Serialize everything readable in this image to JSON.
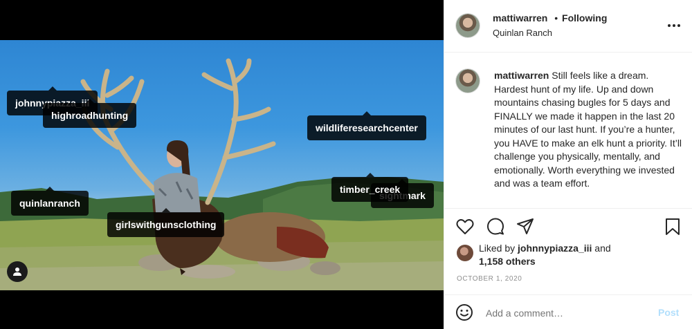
{
  "post": {
    "username": "mattiwarren",
    "follow_separator": "•",
    "follow_status": "Following",
    "location": "Quinlan Ranch",
    "more_icon": "more-horizontal-icon"
  },
  "media": {
    "tags": [
      {
        "name": "tag-johnnypiazza",
        "label": "johnnypiazza_iii"
      },
      {
        "name": "tag-highroadhunting",
        "label": "highroadhunting"
      },
      {
        "name": "tag-wildliferesearchcenter",
        "label": "wildliferesearchcenter"
      },
      {
        "name": "tag-quinlanranch",
        "label": "quinlanranch"
      },
      {
        "name": "tag-sightmark",
        "label": "sightmark"
      },
      {
        "name": "tag-timber-creek",
        "label": "timber_creek"
      },
      {
        "name": "tag-girlswithgunsclothing",
        "label": "girlswithgunsclothing"
      }
    ],
    "user_tag_icon": "user-icon"
  },
  "caption": {
    "username": "mattiwarren",
    "text": "Still feels like a dream. Hardest hunt of my life. Up and down mountains chasing bugles for 5 days and FINALLY we made it happen in the last 20 minutes of our last hunt. If you’re a hunter, you HAVE to make an elk hunt a priority. It’ll challenge you physically, mentally, and emotionally. Worth everything we invested and was a team effort."
  },
  "actions": {
    "like_icon": "heart-icon",
    "comment_icon": "comment-icon",
    "share_icon": "send-icon",
    "save_icon": "bookmark-icon"
  },
  "likes": {
    "prefix": "Liked by",
    "user": "johnnypiazza_iii",
    "conjunction": "and",
    "others": "1,158 others"
  },
  "date": "OCTOBER 1, 2020",
  "comment_box": {
    "emoji_icon": "smiley-icon",
    "placeholder": "Add a comment…",
    "post_label": "Post"
  },
  "colors": {
    "accent_disabled": "#b2dffc",
    "text": "#262626",
    "muted": "#8e8e8e"
  }
}
